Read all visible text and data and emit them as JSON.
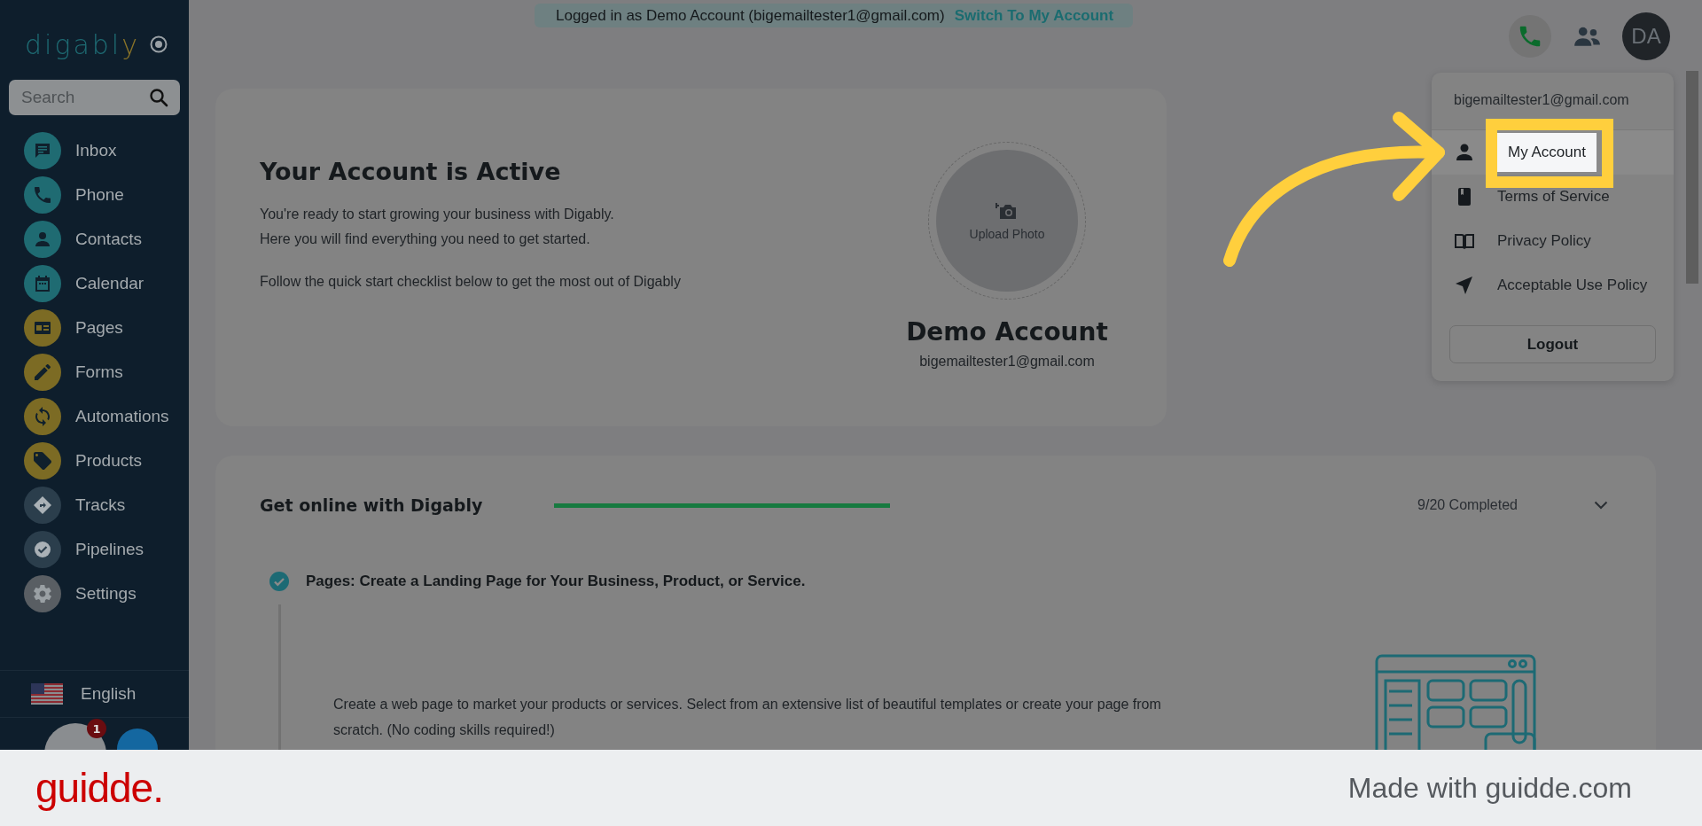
{
  "banner": {
    "text": "Logged in as Demo Account (bigemailtester1@gmail.com)",
    "link": "Switch To My Account"
  },
  "sidebar": {
    "logo": {
      "text": "digabl",
      "accent": "y"
    },
    "search": {
      "placeholder": "Search"
    },
    "items": [
      {
        "label": "Inbox",
        "kind": "inbox",
        "color": "#1f6b72"
      },
      {
        "label": "Phone",
        "kind": "phone",
        "color": "#1f6b72"
      },
      {
        "label": "Contacts",
        "kind": "contacts",
        "color": "#1f6b72"
      },
      {
        "label": "Calendar",
        "kind": "calendar",
        "color": "#1f6b72"
      },
      {
        "label": "Pages",
        "kind": "pages",
        "color": "#7c6b24"
      },
      {
        "label": "Forms",
        "kind": "forms",
        "color": "#7c6b24"
      },
      {
        "label": "Automations",
        "kind": "automations",
        "color": "#7c6b24"
      },
      {
        "label": "Products",
        "kind": "products",
        "color": "#7c6b24"
      },
      {
        "label": "Tracks",
        "kind": "tracks",
        "color": "#2b3e4c"
      },
      {
        "label": "Pipelines",
        "kind": "pipelines",
        "color": "#2b3e4c"
      },
      {
        "label": "Settings",
        "kind": "settings",
        "color": "#595e63"
      }
    ],
    "language": "English",
    "notification_count": "1"
  },
  "header": {
    "avatar": "DA"
  },
  "account_menu": {
    "email": "bigemailtester1@gmail.com",
    "items": [
      {
        "label": "My Account",
        "kind": "person",
        "selected": true
      },
      {
        "label": "Terms of Service",
        "kind": "book",
        "selected": false
      },
      {
        "label": "Privacy Policy",
        "kind": "open-book",
        "selected": false
      },
      {
        "label": "Acceptable Use Policy",
        "kind": "send",
        "selected": false
      }
    ],
    "logout": "Logout"
  },
  "account_card": {
    "title": "Your Account is Active",
    "lines": [
      "You're ready to start growing your business with Digably.",
      "Here you will find everything you need to get started."
    ],
    "note": "Follow the quick start checklist below to get the most out of Digably",
    "upload": "Upload Photo",
    "name": "Demo Account",
    "email": "bigemailtester1@gmail.com"
  },
  "checklist": {
    "title": "Get online with Digably",
    "progress": "9/20 Completed",
    "expanded": true,
    "tasks": [
      {
        "title": "Pages: Create a Landing Page for Your Business, Product, or Service.",
        "checked": true,
        "description": "Create a web page to market your products or services. Select from an extensive list of beautiful templates or create your page from scratch. (No coding skills required!)"
      }
    ]
  },
  "footer": {
    "brand": "guidde.",
    "credit": "Made with guidde.com"
  }
}
